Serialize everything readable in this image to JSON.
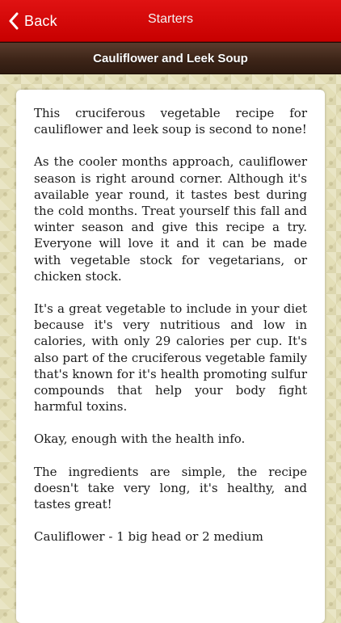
{
  "navbar": {
    "back_label": "Back",
    "title": "Starters",
    "color": "#d40000"
  },
  "subheader": {
    "title": "Cauliflower and Leek Soup"
  },
  "article": {
    "paragraphs": [
      "This cruciferous vegetable recipe for cauliflower and leek soup is second to none!",
      "As the cooler months approach, cauliflower season is right around corner. Although it's available year round, it tastes best during the cold months. Treat yourself this fall and winter season and give this recipe a try. Everyone will love it and it can be made with vegetable stock for vegetarians, or chicken stock.",
      "It's a great vegetable to include in your diet because it's very nutritious and low in calories, with only 29 calories per cup. It's also part of the cruciferous vegetable family that's known for it's health promoting sulfur compounds that help your body fight harmful toxins.",
      "Okay, enough with the health info.",
      "The ingredients are simple, the recipe doesn't take very long, it's healthy, and tastes great!",
      "Cauliflower - 1 big head or 2 medium"
    ]
  }
}
